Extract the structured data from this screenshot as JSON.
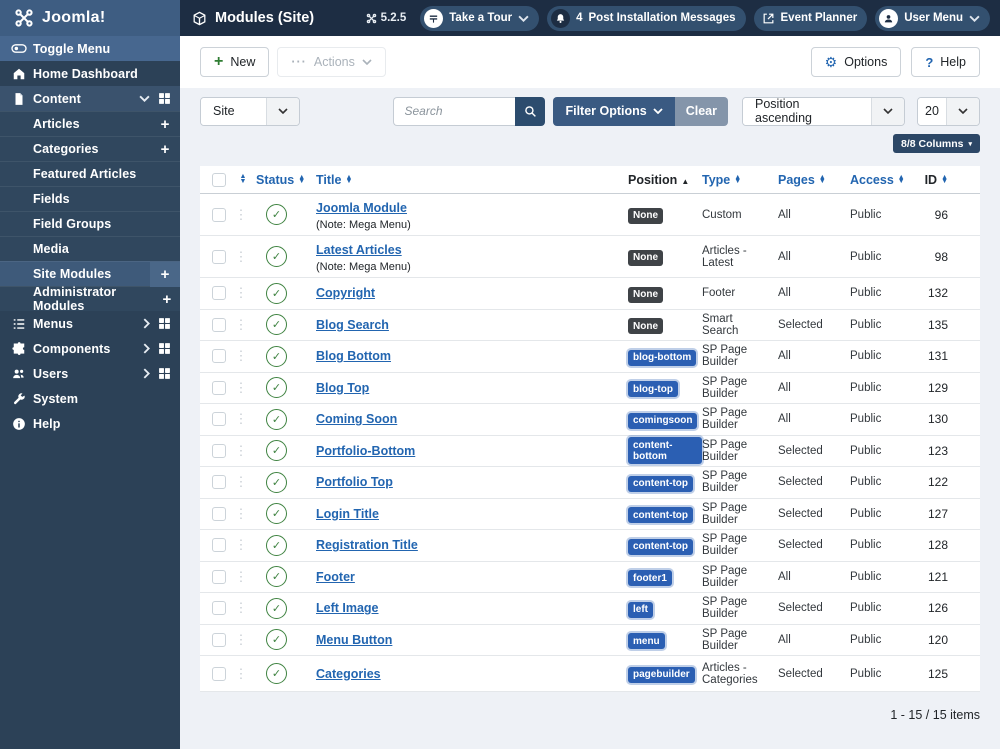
{
  "header": {
    "logo_text": "Joomla!",
    "title": "Modules (Site)",
    "version": "5.2.5",
    "pills": [
      {
        "name": "take-a-tour",
        "label": "Take a Tour",
        "icon": "map",
        "icon_style": "light",
        "chevron": true
      },
      {
        "name": "post-installation-messages",
        "label": "Post Installation Messages",
        "icon": "bell",
        "icon_style": "dark",
        "count": "4"
      },
      {
        "name": "event-planner",
        "label": "Event Planner",
        "icon": "external",
        "icon_style": "plain"
      },
      {
        "name": "user-menu",
        "label": "User Menu",
        "icon": "user",
        "icon_style": "light",
        "chevron": true
      }
    ]
  },
  "sidebar": {
    "toggle_label": "Toggle Menu",
    "items": [
      {
        "label": "Home Dashboard",
        "icon": "home"
      },
      {
        "label": "Content",
        "icon": "file",
        "parent": true,
        "chevron": "down",
        "grid": true
      },
      {
        "label": "Articles",
        "indent": true,
        "plus": true
      },
      {
        "label": "Categories",
        "indent": true,
        "plus": true
      },
      {
        "label": "Featured Articles",
        "indent": true
      },
      {
        "label": "Fields",
        "indent": true
      },
      {
        "label": "Field Groups",
        "indent": true
      },
      {
        "label": "Media",
        "indent": true
      },
      {
        "label": "Site Modules",
        "indent": true,
        "plus": true,
        "active": true
      },
      {
        "label": "Administrator Modules",
        "indent": true,
        "plus": true
      },
      {
        "label": "Menus",
        "icon": "list",
        "chevron": "right",
        "grid": true
      },
      {
        "label": "Components",
        "icon": "puzzle",
        "chevron": "right",
        "grid": true
      },
      {
        "label": "Users",
        "icon": "users",
        "chevron": "right",
        "grid": true
      },
      {
        "label": "System",
        "icon": "wrench"
      },
      {
        "label": "Help",
        "icon": "info"
      }
    ]
  },
  "toolbar": {
    "new_label": "New",
    "actions_label": "Actions",
    "options_label": "Options",
    "help_label": "Help"
  },
  "filters": {
    "site_value": "Site",
    "search_placeholder": "Search",
    "filter_options_label": "Filter Options",
    "clear_label": "Clear",
    "sort_value": "Position ascending",
    "limit_value": "20",
    "columns_label": "8/8 Columns"
  },
  "table": {
    "headers": {
      "status": "Status",
      "title": "Title",
      "position": "Position",
      "type": "Type",
      "pages": "Pages",
      "access": "Access",
      "id": "ID"
    },
    "rows": [
      {
        "title": "Joomla Module",
        "note": "(Note: Mega Menu)",
        "position": "None",
        "badge": "dark",
        "type": "Custom",
        "pages": "All",
        "access": "Public",
        "id": "96"
      },
      {
        "title": "Latest Articles",
        "note": "(Note: Mega Menu)",
        "position": "None",
        "badge": "dark",
        "type": "Articles - Latest",
        "pages": "All",
        "access": "Public",
        "id": "98"
      },
      {
        "title": "Copyright",
        "position": "None",
        "badge": "dark",
        "type": "Footer",
        "pages": "All",
        "access": "Public",
        "id": "132"
      },
      {
        "title": "Blog Search",
        "position": "None",
        "badge": "dark",
        "type": "Smart Search",
        "pages": "Selected",
        "access": "Public",
        "id": "135"
      },
      {
        "title": "Blog Bottom",
        "position": "blog-bottom",
        "badge": "blue",
        "type": "SP Page Builder",
        "pages": "All",
        "access": "Public",
        "id": "131"
      },
      {
        "title": "Blog Top",
        "position": "blog-top",
        "badge": "blue",
        "type": "SP Page Builder",
        "pages": "All",
        "access": "Public",
        "id": "129"
      },
      {
        "title": "Coming Soon",
        "position": "comingsoon",
        "badge": "blue",
        "type": "SP Page Builder",
        "pages": "All",
        "access": "Public",
        "id": "130"
      },
      {
        "title": "Portfolio-Bottom",
        "position": "content-bottom",
        "badge": "blue",
        "type": "SP Page Builder",
        "pages": "Selected",
        "access": "Public",
        "id": "123"
      },
      {
        "title": "Portfolio Top",
        "position": "content-top",
        "badge": "blue",
        "type": "SP Page Builder",
        "pages": "Selected",
        "access": "Public",
        "id": "122"
      },
      {
        "title": "Login Title",
        "position": "content-top",
        "badge": "blue",
        "type": "SP Page Builder",
        "pages": "Selected",
        "access": "Public",
        "id": "127"
      },
      {
        "title": "Registration Title",
        "position": "content-top",
        "badge": "blue",
        "type": "SP Page Builder",
        "pages": "Selected",
        "access": "Public",
        "id": "128"
      },
      {
        "title": "Footer",
        "position": "footer1",
        "badge": "blue",
        "type": "SP Page Builder",
        "pages": "All",
        "access": "Public",
        "id": "121"
      },
      {
        "title": "Left Image",
        "position": "left",
        "badge": "blue",
        "type": "SP Page Builder",
        "pages": "Selected",
        "access": "Public",
        "id": "126"
      },
      {
        "title": "Menu Button",
        "position": "menu",
        "badge": "blue",
        "type": "SP Page Builder",
        "pages": "All",
        "access": "Public",
        "id": "120"
      },
      {
        "title": "Categories",
        "position": "pagebuilder",
        "badge": "blue",
        "type": "Articles - Categories",
        "pages": "Selected",
        "access": "Public",
        "id": "125"
      }
    ]
  },
  "footer": {
    "count": "1 - 15 / 15 items"
  },
  "colors": {
    "header_bg": "#1d2d43",
    "logo_bg": "#3e5d82",
    "sidebar_bg": "#2c4157",
    "sidebar_active": "#3e5a7a",
    "link_blue": "#2265b0",
    "status_green": "#3f8341",
    "badge_dark": "#3f4347",
    "badge_blue": "#2b5fb3",
    "filter_btn": "#3a5a82",
    "clear_btn": "#8495aa",
    "page_bg": "#eef1f6"
  }
}
